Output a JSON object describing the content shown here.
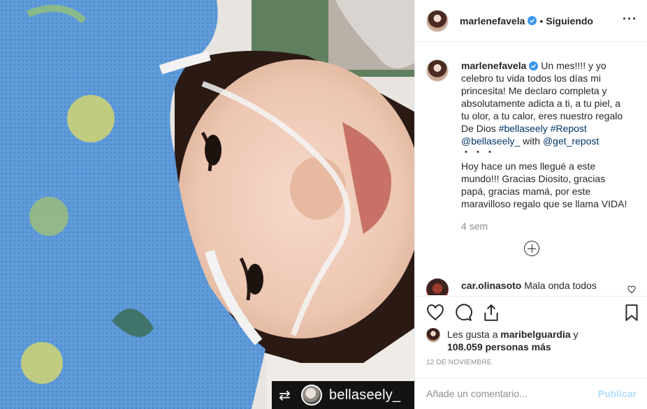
{
  "post": {
    "author": "marlenefavela",
    "following_label": "Siguiendo",
    "more_icon": "more-options-icon",
    "caption": {
      "username": "marlenefavela",
      "part1": " Un mes!!!! y yo celebro tu vida todos los días mi princesita! Me declaro completa y absolutamente adicta a ti, a tu piel, a tu olor, a tu calor, eres nuestro regalo De Dios ",
      "tag1": "#bellaseely",
      "tag2": "#Repost",
      "mention1": "@bellaseely_",
      "with_text": " with ",
      "mention2": "@get_repost",
      "dots": "・・・",
      "part2": "Hoy hace un mes llegué a este mundo!!! Gracias Diosito, gracias papá, gracias mamá, por este maravilloso regalo que se llama VIDA!",
      "time": "4 sem"
    },
    "comment": {
      "username": "car.olinasoto",
      "text": "Mala onda todos"
    },
    "likes": {
      "prefix": "Les gusta a ",
      "user": "maribelguardia",
      "middle": " y",
      "count": "108.059 personas más"
    },
    "date": "12 DE NOVIEMBRE",
    "add_comment_placeholder": "Añade un comentario...",
    "publish_label": "Publicar"
  },
  "photo": {
    "repost_user": "bellaseely_",
    "repost_icon": "repost-icon"
  },
  "colors": {
    "link": "#003569",
    "verified": "#3897f0",
    "muted": "#8e8e8e",
    "publish_disabled": "#b2dffc"
  }
}
